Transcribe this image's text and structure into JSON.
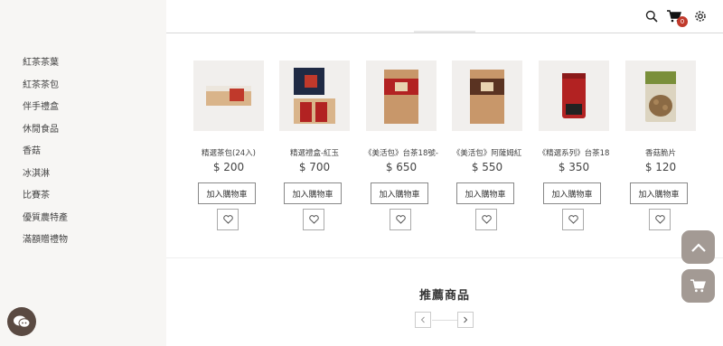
{
  "sidebar": {
    "items": [
      {
        "label": "紅茶茶葉"
      },
      {
        "label": "紅茶茶包"
      },
      {
        "label": "伴手禮盒"
      },
      {
        "label": "休閒食品"
      },
      {
        "label": "香菇"
      },
      {
        "label": "冰淇淋"
      },
      {
        "label": "比賽茶"
      },
      {
        "label": "優質農特產"
      },
      {
        "label": "滿額贈禮物"
      }
    ]
  },
  "header": {
    "search_icon": "search-icon",
    "cart_icon": "cart-icon",
    "cart_count": "0",
    "settings_icon": "gear-icon"
  },
  "products": [
    {
      "name": "精選茶包(24入)",
      "price": "$ 200",
      "add_label": "加入購物車"
    },
    {
      "name": "精選禮盒-紅玉",
      "price": "$ 700",
      "add_label": "加入購物車"
    },
    {
      "name": "《美活包》台茶18號-",
      "price": "$ 650",
      "add_label": "加入購物車"
    },
    {
      "name": "《美活包》阿薩姆紅",
      "price": "$ 550",
      "add_label": "加入購物車"
    },
    {
      "name": "《精選系列》台茶18",
      "price": "$ 350",
      "add_label": "加入購物車"
    },
    {
      "name": "香菇脆片",
      "price": "$ 120",
      "add_label": "加入購物車"
    }
  ],
  "recommended": {
    "title": "推薦商品"
  },
  "colors": {
    "sidebar_bg": "#f7f6f4",
    "float_button": "#a39a94",
    "chat_button": "#5a4a42",
    "badge": "#c0392b"
  }
}
